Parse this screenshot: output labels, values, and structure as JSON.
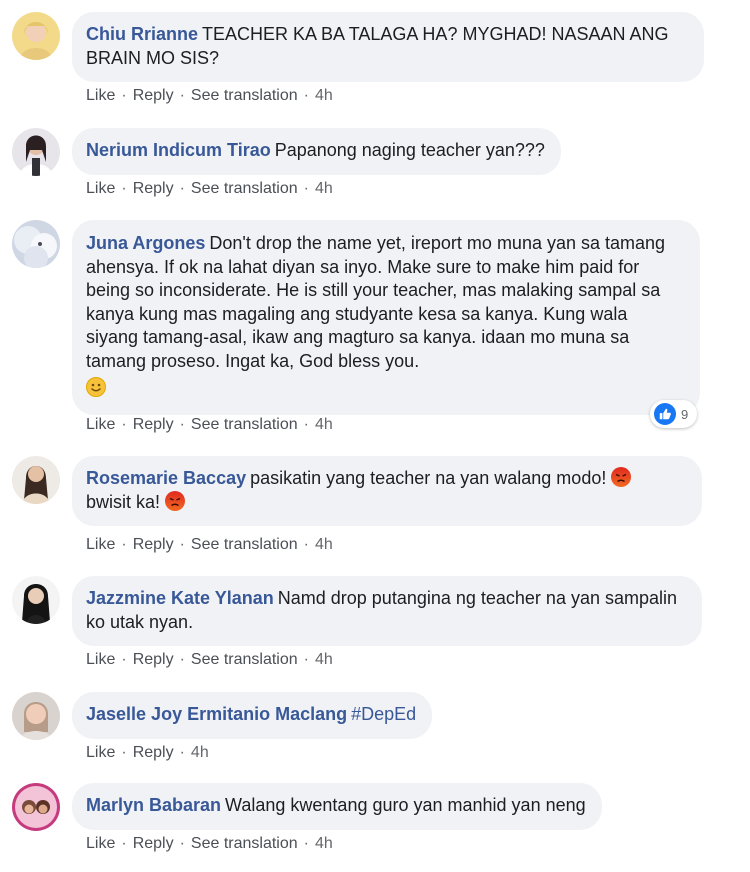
{
  "actions": {
    "like": "Like",
    "reply": "Reply",
    "see_translation": "See translation",
    "separator": "·"
  },
  "colors": {
    "author": "#385898",
    "bubble": "#f0f2f5",
    "action": "#65676b",
    "like_badge": "#1877f2"
  },
  "comments": [
    {
      "author": "Chiu Rrianne",
      "text": "TEACHER KA BA TALAGA HA? MYGHAD! NASAAN ANG BRAIN MO SIS?",
      "time": "4h",
      "has_translation": true
    },
    {
      "author": "Nerium Indicum Tirao",
      "text": "Papanong naging teacher yan???",
      "time": "4h",
      "has_translation": true
    },
    {
      "author": "Juna Argones",
      "text": "Don't drop the name yet, ireport mo muna yan sa tamang ahensya. If ok na lahat diyan sa inyo. Make sure to make him paid for being so inconsiderate. He is still your teacher, mas malaking sampal sa kanya kung mas magaling ang studyante kesa sa kanya. Kung wala siyang tamang-asal, ikaw ang magturo sa kanya. idaan mo muna sa tamang proseso. Ingat ka, God bless you.",
      "emoji": "smile-emoji",
      "time": "4h",
      "has_translation": true,
      "reaction_count": "9",
      "reaction_icon": "like-icon"
    },
    {
      "author": "Rosemarie Baccay",
      "text_before": "pasikatin yang teacher na yan walang modo!",
      "emoji": "angry-emoji",
      "text_after": "bwisit ka!",
      "time": "4h",
      "has_translation": true
    },
    {
      "author": "Jazzmine Kate Ylanan",
      "text": "Namd drop putangina ng teacher na yan sampalin ko utak nyan.",
      "time": "4h",
      "has_translation": true
    },
    {
      "author": "Jaselle Joy Ermitanio Maclang",
      "hashtag": "#DepEd",
      "time": "4h",
      "has_translation": false
    },
    {
      "author": "Marlyn Babaran",
      "text": "Walang kwentang guro yan manhid yan neng",
      "time": "4h",
      "has_translation": true
    }
  ]
}
